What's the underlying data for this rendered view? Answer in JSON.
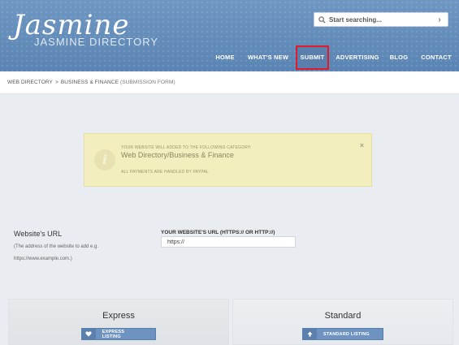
{
  "brand": {
    "script": "Jasmine",
    "subtitle": "JASMINE DIRECTORY"
  },
  "search": {
    "placeholder": "Start searching...",
    "go": "›"
  },
  "nav": {
    "items": [
      {
        "label": "HOME"
      },
      {
        "label": "WHAT'S NEW"
      },
      {
        "label": "SUBMIT"
      },
      {
        "label": "ADVERTISING"
      },
      {
        "label": "BLOG"
      },
      {
        "label": "CONTACT"
      }
    ],
    "active": "SUBMIT"
  },
  "breadcrumb": {
    "root": "WEB DIRECTORY",
    "separator": ">",
    "current": "BUSINESS & FINANCE",
    "suffix": "(SUBMISSION FORM)"
  },
  "notice": {
    "line1": "YOUR WEBSITE WILL ADDED TO THE FOLLOWING CATEGORY:",
    "category": "Web Directory/Business & Finance",
    "line2": "ALL PAYMENTS ARE HANDLED BY PAYPAL",
    "close": "×",
    "icon": "i"
  },
  "url_section": {
    "title": "Website's URL",
    "help1": "(The address of the website to add e.g.",
    "help2": "https://www.example.com.)",
    "field_label": "YOUR WEBSITE'S URL (HTTPS:// OR HTTP://)",
    "field_value": "https://"
  },
  "plans": [
    {
      "title": "Express",
      "button": "EXPRESS LISTING",
      "icon": "heart-icon"
    },
    {
      "title": "Standard",
      "button": "STANDARD LISTING",
      "icon": "arrow-up-icon"
    }
  ],
  "colors": {
    "header": "#5a84b3",
    "button": "#6e93c0",
    "highlight": "#e11a2b",
    "notice_bg": "#f3eebd"
  }
}
